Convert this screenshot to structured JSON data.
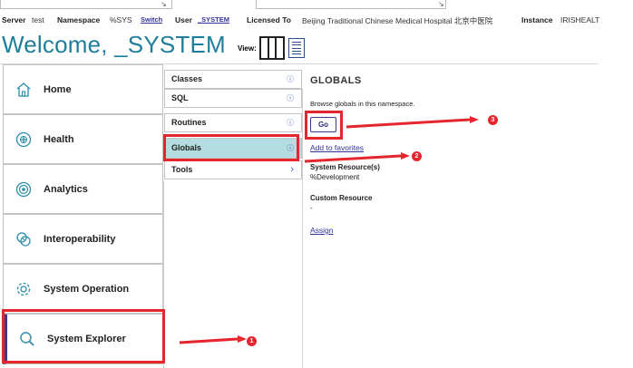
{
  "infobar": {
    "server_label": "Server",
    "server_value": "test",
    "namespace_label": "Namespace",
    "namespace_value": "%SYS",
    "switch_link": "Switch",
    "user_label": "User",
    "user_value": "_SYSTEM",
    "licensed_label": "Licensed To",
    "licensed_value": "Beijing Traditional Chinese Medical Hospital 北京中医院",
    "instance_label": "Instance",
    "instance_value": "IRISHEALT"
  },
  "header": {
    "welcome": "Welcome, _SYSTEM",
    "view_label": "View:"
  },
  "left_menu": [
    {
      "label": "Home",
      "icon": "home-icon"
    },
    {
      "label": "Health",
      "icon": "health-icon"
    },
    {
      "label": "Analytics",
      "icon": "analytics-icon"
    },
    {
      "label": "Interoperability",
      "icon": "interoperability-icon"
    },
    {
      "label": "System Operation",
      "icon": "gear-icon"
    },
    {
      "label": "System Explorer",
      "icon": "search-icon"
    }
  ],
  "mid_menu": [
    {
      "label": "Classes",
      "icon": "info-icon"
    },
    {
      "label": "SQL",
      "icon": "info-icon"
    },
    {
      "label": "Routines",
      "icon": "info-icon"
    },
    {
      "label": "Globals",
      "icon": "info-icon"
    },
    {
      "label": "Tools",
      "icon": "chevron-right-icon"
    }
  ],
  "mid_glyphs": {
    "info": "ⓘ",
    "chevron": "›"
  },
  "panel": {
    "title": "GLOBALS",
    "description": "Browse globals in this namespace.",
    "go_label": "Go",
    "favorites_link": "Add to favorites",
    "resource_label": "System Resource(s)",
    "resource_value": "%Development",
    "custom_resource_label": "Custom Resource",
    "custom_resource_value": "-",
    "assign_link": "Assign"
  },
  "annotations": {
    "badge_1": "1",
    "badge_2": "2",
    "badge_3": "3",
    "color": "#e5262e"
  },
  "colors": {
    "welcome": "#1f7f9b",
    "selected_row": "#b3dde0",
    "link": "#333399"
  }
}
